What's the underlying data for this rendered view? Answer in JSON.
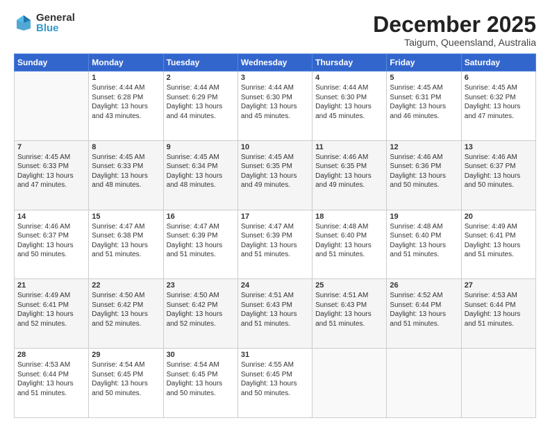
{
  "logo": {
    "general": "General",
    "blue": "Blue"
  },
  "header": {
    "month": "December 2025",
    "location": "Taigum, Queensland, Australia"
  },
  "days_of_week": [
    "Sunday",
    "Monday",
    "Tuesday",
    "Wednesday",
    "Thursday",
    "Friday",
    "Saturday"
  ],
  "weeks": [
    [
      {
        "day": "",
        "detail": ""
      },
      {
        "day": "1",
        "detail": "Sunrise: 4:44 AM\nSunset: 6:28 PM\nDaylight: 13 hours\nand 43 minutes."
      },
      {
        "day": "2",
        "detail": "Sunrise: 4:44 AM\nSunset: 6:29 PM\nDaylight: 13 hours\nand 44 minutes."
      },
      {
        "day": "3",
        "detail": "Sunrise: 4:44 AM\nSunset: 6:30 PM\nDaylight: 13 hours\nand 45 minutes."
      },
      {
        "day": "4",
        "detail": "Sunrise: 4:44 AM\nSunset: 6:30 PM\nDaylight: 13 hours\nand 45 minutes."
      },
      {
        "day": "5",
        "detail": "Sunrise: 4:45 AM\nSunset: 6:31 PM\nDaylight: 13 hours\nand 46 minutes."
      },
      {
        "day": "6",
        "detail": "Sunrise: 4:45 AM\nSunset: 6:32 PM\nDaylight: 13 hours\nand 47 minutes."
      }
    ],
    [
      {
        "day": "7",
        "detail": "Sunrise: 4:45 AM\nSunset: 6:33 PM\nDaylight: 13 hours\nand 47 minutes."
      },
      {
        "day": "8",
        "detail": "Sunrise: 4:45 AM\nSunset: 6:33 PM\nDaylight: 13 hours\nand 48 minutes."
      },
      {
        "day": "9",
        "detail": "Sunrise: 4:45 AM\nSunset: 6:34 PM\nDaylight: 13 hours\nand 48 minutes."
      },
      {
        "day": "10",
        "detail": "Sunrise: 4:45 AM\nSunset: 6:35 PM\nDaylight: 13 hours\nand 49 minutes."
      },
      {
        "day": "11",
        "detail": "Sunrise: 4:46 AM\nSunset: 6:35 PM\nDaylight: 13 hours\nand 49 minutes."
      },
      {
        "day": "12",
        "detail": "Sunrise: 4:46 AM\nSunset: 6:36 PM\nDaylight: 13 hours\nand 50 minutes."
      },
      {
        "day": "13",
        "detail": "Sunrise: 4:46 AM\nSunset: 6:37 PM\nDaylight: 13 hours\nand 50 minutes."
      }
    ],
    [
      {
        "day": "14",
        "detail": "Sunrise: 4:46 AM\nSunset: 6:37 PM\nDaylight: 13 hours\nand 50 minutes."
      },
      {
        "day": "15",
        "detail": "Sunrise: 4:47 AM\nSunset: 6:38 PM\nDaylight: 13 hours\nand 51 minutes."
      },
      {
        "day": "16",
        "detail": "Sunrise: 4:47 AM\nSunset: 6:39 PM\nDaylight: 13 hours\nand 51 minutes."
      },
      {
        "day": "17",
        "detail": "Sunrise: 4:47 AM\nSunset: 6:39 PM\nDaylight: 13 hours\nand 51 minutes."
      },
      {
        "day": "18",
        "detail": "Sunrise: 4:48 AM\nSunset: 6:40 PM\nDaylight: 13 hours\nand 51 minutes."
      },
      {
        "day": "19",
        "detail": "Sunrise: 4:48 AM\nSunset: 6:40 PM\nDaylight: 13 hours\nand 51 minutes."
      },
      {
        "day": "20",
        "detail": "Sunrise: 4:49 AM\nSunset: 6:41 PM\nDaylight: 13 hours\nand 51 minutes."
      }
    ],
    [
      {
        "day": "21",
        "detail": "Sunrise: 4:49 AM\nSunset: 6:41 PM\nDaylight: 13 hours\nand 52 minutes."
      },
      {
        "day": "22",
        "detail": "Sunrise: 4:50 AM\nSunset: 6:42 PM\nDaylight: 13 hours\nand 52 minutes."
      },
      {
        "day": "23",
        "detail": "Sunrise: 4:50 AM\nSunset: 6:42 PM\nDaylight: 13 hours\nand 52 minutes."
      },
      {
        "day": "24",
        "detail": "Sunrise: 4:51 AM\nSunset: 6:43 PM\nDaylight: 13 hours\nand 51 minutes."
      },
      {
        "day": "25",
        "detail": "Sunrise: 4:51 AM\nSunset: 6:43 PM\nDaylight: 13 hours\nand 51 minutes."
      },
      {
        "day": "26",
        "detail": "Sunrise: 4:52 AM\nSunset: 6:44 PM\nDaylight: 13 hours\nand 51 minutes."
      },
      {
        "day": "27",
        "detail": "Sunrise: 4:53 AM\nSunset: 6:44 PM\nDaylight: 13 hours\nand 51 minutes."
      }
    ],
    [
      {
        "day": "28",
        "detail": "Sunrise: 4:53 AM\nSunset: 6:44 PM\nDaylight: 13 hours\nand 51 minutes."
      },
      {
        "day": "29",
        "detail": "Sunrise: 4:54 AM\nSunset: 6:45 PM\nDaylight: 13 hours\nand 50 minutes."
      },
      {
        "day": "30",
        "detail": "Sunrise: 4:54 AM\nSunset: 6:45 PM\nDaylight: 13 hours\nand 50 minutes."
      },
      {
        "day": "31",
        "detail": "Sunrise: 4:55 AM\nSunset: 6:45 PM\nDaylight: 13 hours\nand 50 minutes."
      },
      {
        "day": "",
        "detail": ""
      },
      {
        "day": "",
        "detail": ""
      },
      {
        "day": "",
        "detail": ""
      }
    ]
  ]
}
